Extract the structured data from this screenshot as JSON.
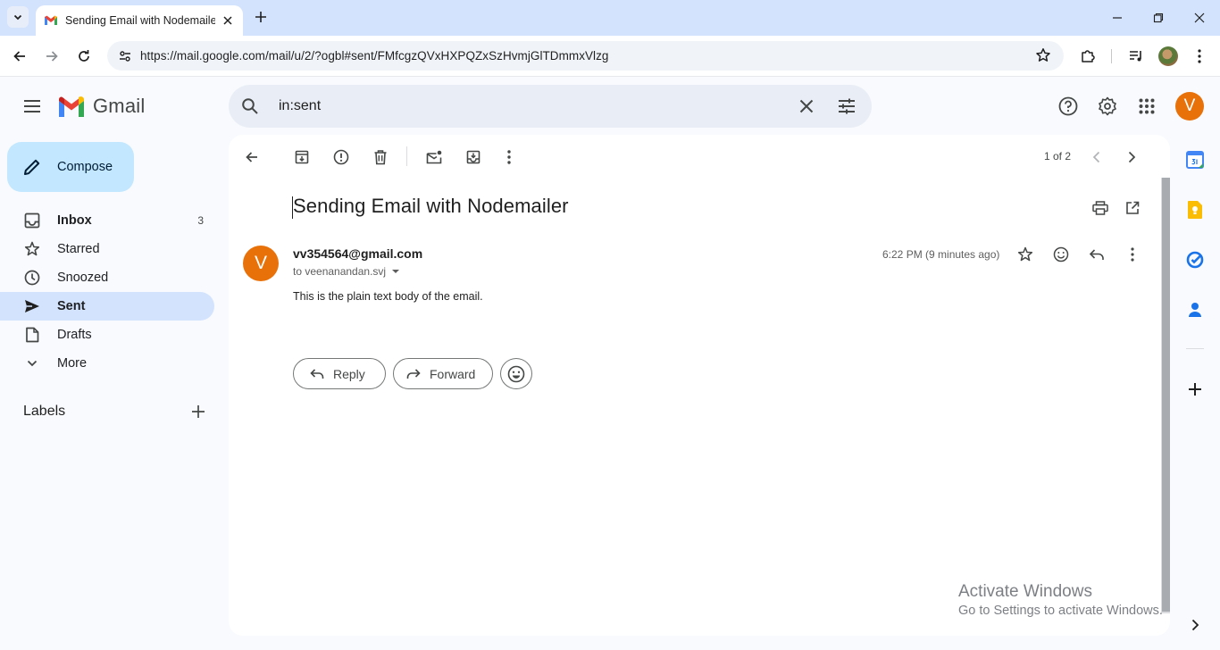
{
  "browser": {
    "tab_title": "Sending Email with Nodemailer",
    "url": "https://mail.google.com/mail/u/2/?ogbl#sent/FMfcgzQVxHXPQZxSzHvmjGlTDmmxVlzg"
  },
  "gmail": {
    "wordmark": "Gmail",
    "search_query": "in:sent",
    "user_initial": "V"
  },
  "sidebar": {
    "compose_label": "Compose",
    "items": [
      {
        "label": "Inbox",
        "count": "3",
        "icon": "inbox-icon"
      },
      {
        "label": "Starred",
        "count": "",
        "icon": "star-icon"
      },
      {
        "label": "Snoozed",
        "count": "",
        "icon": "clock-icon"
      },
      {
        "label": "Sent",
        "count": "",
        "icon": "send-icon"
      },
      {
        "label": "Drafts",
        "count": "",
        "icon": "draft-icon"
      },
      {
        "label": "More",
        "count": "",
        "icon": "chevron-down-icon"
      }
    ],
    "labels_title": "Labels"
  },
  "message": {
    "pager": "1 of 2",
    "subject": "Sending Email with Nodemailer",
    "sender_initial": "V",
    "sender": "vv354564@gmail.com",
    "recipient": "to veenanandan.svj",
    "time": "6:22 PM (9 minutes ago)",
    "body": "This is the plain text body of the email.",
    "reply_label": "Reply",
    "forward_label": "Forward"
  },
  "watermark": {
    "line1": "Activate Windows",
    "line2": "Go to Settings to activate Windows."
  },
  "colors": {
    "accent": "#0b57d0",
    "compose_bg": "#c2e7ff",
    "active_nav": "#d3e3fd",
    "avatar": "#e8710a"
  }
}
